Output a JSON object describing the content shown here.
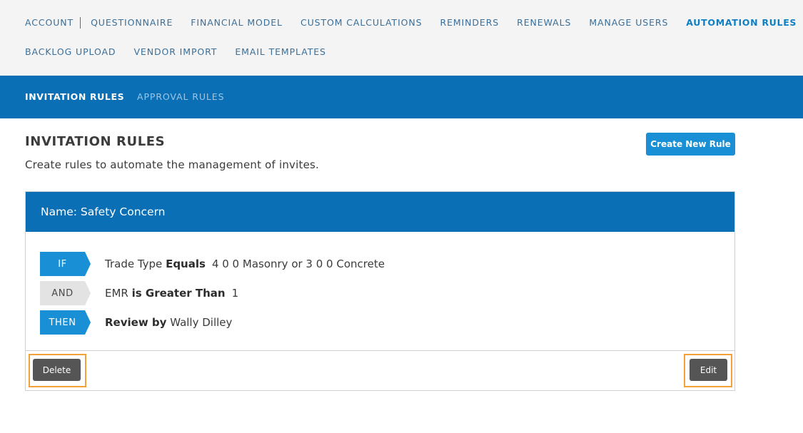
{
  "topnav": {
    "row1": [
      "ACCOUNT",
      "QUESTIONNAIRE",
      "FINANCIAL MODEL",
      "CUSTOM CALCULATIONS",
      "REMINDERS",
      "RENEWALS",
      "MANAGE USERS",
      "AUTOMATION RULES"
    ],
    "row2": [
      "BACKLOG UPLOAD",
      "VENDOR IMPORT",
      "EMAIL TEMPLATES"
    ],
    "active": "AUTOMATION RULES"
  },
  "subnav": {
    "tabs": [
      "INVITATION RULES",
      "APPROVAL RULES"
    ],
    "active": "INVITATION RULES"
  },
  "page": {
    "title": "INVITATION RULES",
    "description": "Create rules to automate the management of invites.",
    "create_button": "Create New Rule"
  },
  "rule": {
    "name": "Name: Safety Concern",
    "conditions": [
      {
        "tag": "IF",
        "field": "Trade Type",
        "operator": "Equals",
        "value": "4 0 0 Masonry or 3 0 0 Concrete"
      },
      {
        "tag": "AND",
        "field": "EMR",
        "operator": "is Greater Than",
        "value": "1"
      }
    ],
    "action": {
      "tag": "THEN",
      "verb": "Review by",
      "target": "Wally Dilley"
    },
    "delete_label": "Delete",
    "edit_label": "Edit"
  },
  "colors": {
    "primary": "#0b6fb6",
    "button_blue": "#1990d5",
    "dark_button": "#555555",
    "highlight": "#f3a23a",
    "nav_background": "#f4f4f4"
  }
}
